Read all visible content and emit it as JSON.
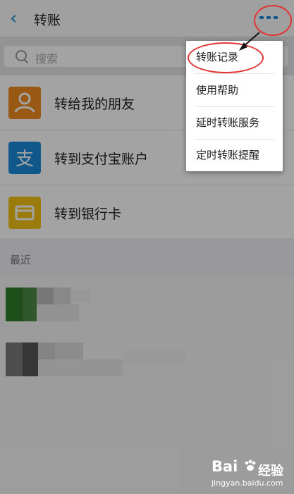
{
  "header": {
    "back_icon": "chevron-left-icon",
    "title": "转账",
    "more_icon": "more-dots-icon",
    "accent": "#1a8ad8"
  },
  "search": {
    "placeholder": "搜索"
  },
  "transfer_options": [
    {
      "label": "转给我的朋友",
      "icon": "contact-person-icon",
      "color": "#f08a1e"
    },
    {
      "label": "转到支付宝账户",
      "icon": "alipay-logo-icon",
      "color": "#1a8ad8"
    },
    {
      "label": "转到银行卡",
      "icon": "bank-card-icon",
      "color": "#f2c112"
    }
  ],
  "recent": {
    "label": "最近"
  },
  "menu": {
    "items": [
      "转账记录",
      "使用帮助",
      "延时转账服务",
      "定时转账提醒"
    ]
  },
  "annotation": {
    "highlight_color": "#e23434"
  },
  "watermark": {
    "brand": "Bai",
    "brand_tail": "经验",
    "url": "jingyan.baidu.com"
  }
}
